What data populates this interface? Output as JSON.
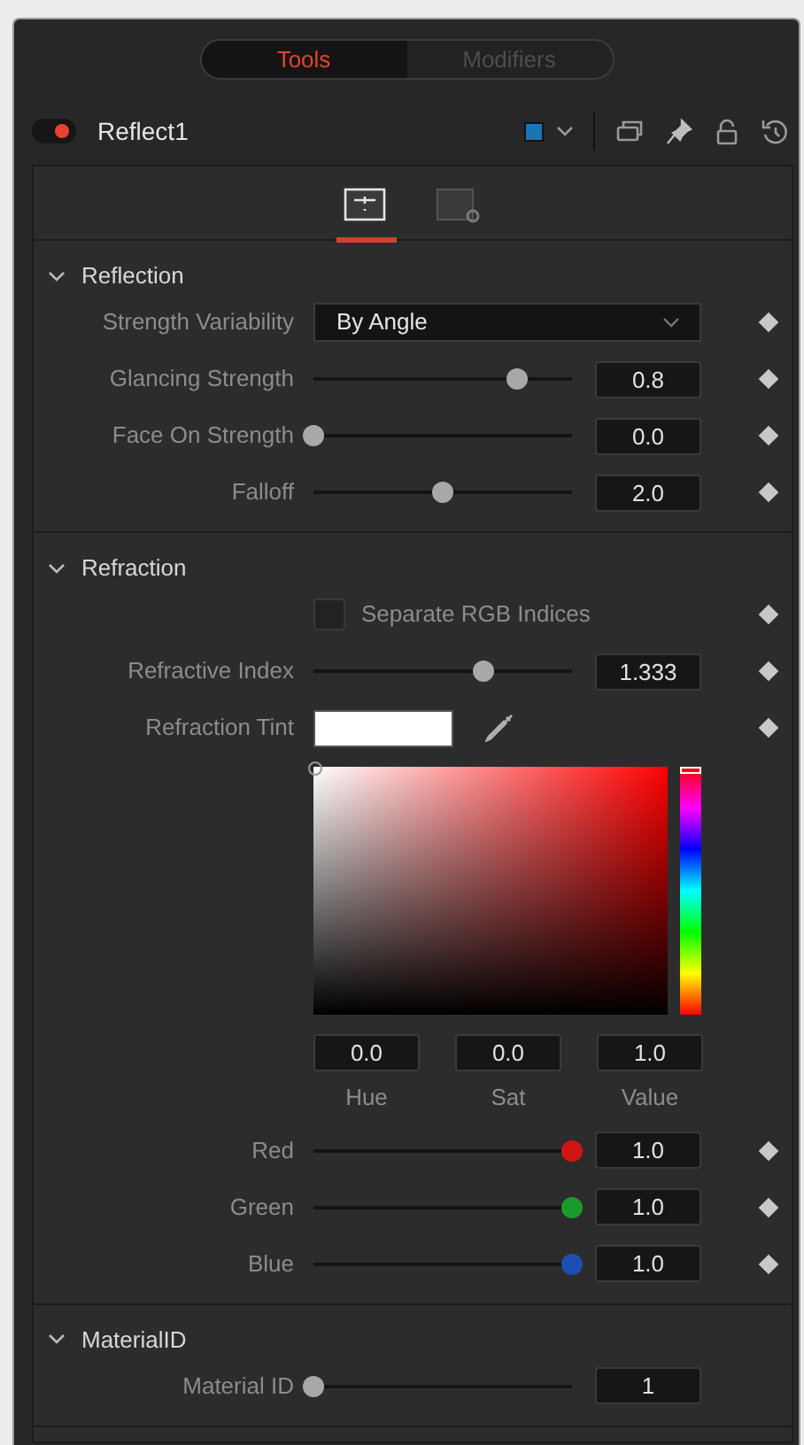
{
  "tabs": [
    {
      "label": "Tools",
      "selected": true
    },
    {
      "label": "Modifiers",
      "selected": false
    }
  ],
  "node": {
    "name": "Reflect1",
    "enabled": true,
    "color": "#1b75b5"
  },
  "panel_tabs": [
    {
      "kind": "controls",
      "selected": true
    },
    {
      "kind": "settings",
      "selected": false
    }
  ],
  "sections": [
    {
      "title": "Reflection",
      "expanded": true,
      "rows": [
        {
          "kind": "dropdown",
          "label": "Strength Variability",
          "value": "By Angle",
          "keyframe": true
        },
        {
          "kind": "slider",
          "label": "Glancing Strength",
          "level": 0.79,
          "value": "0.8",
          "keyframe": true
        },
        {
          "kind": "slider",
          "label": "Face On Strength",
          "level": 0,
          "value": "0.0",
          "keyframe": true
        },
        {
          "kind": "slider",
          "label": "Falloff",
          "level": 0.5,
          "value": "2.0",
          "keyframe": true
        }
      ]
    },
    {
      "title": "Refraction",
      "expanded": true,
      "rows": [
        {
          "kind": "checkbox",
          "label": "Separate RGB Indices",
          "checked": false,
          "keyframe": true
        },
        {
          "kind": "slider",
          "label": "Refractive Index",
          "level": 0.66,
          "value": "1.333",
          "keyframe": true
        },
        {
          "kind": "swatch",
          "label": "Refraction Tint",
          "color": "#ffffff",
          "keyframe": true
        },
        {
          "kind": "picker",
          "fields": [
            {
              "label": "Hue",
              "value": "0.0"
            },
            {
              "label": "Sat",
              "value": "0.0"
            },
            {
              "label": "Value",
              "value": "1.0"
            }
          ],
          "keyframe": false
        },
        {
          "kind": "slider",
          "label": "Red",
          "level": 1,
          "value": "1.0",
          "color": "#d01515",
          "keyframe": true
        },
        {
          "kind": "slider",
          "label": "Green",
          "level": 1,
          "value": "1.0",
          "color": "#1a9a2a",
          "keyframe": true
        },
        {
          "kind": "slider",
          "label": "Blue",
          "level": 1,
          "value": "1.0",
          "color": "#1d4fb0",
          "keyframe": true
        }
      ]
    },
    {
      "title": "MaterialID",
      "expanded": true,
      "rows": [
        {
          "kind": "slider",
          "label": "Material ID",
          "level": 0,
          "value": "1",
          "keyframe": false
        }
      ]
    }
  ]
}
